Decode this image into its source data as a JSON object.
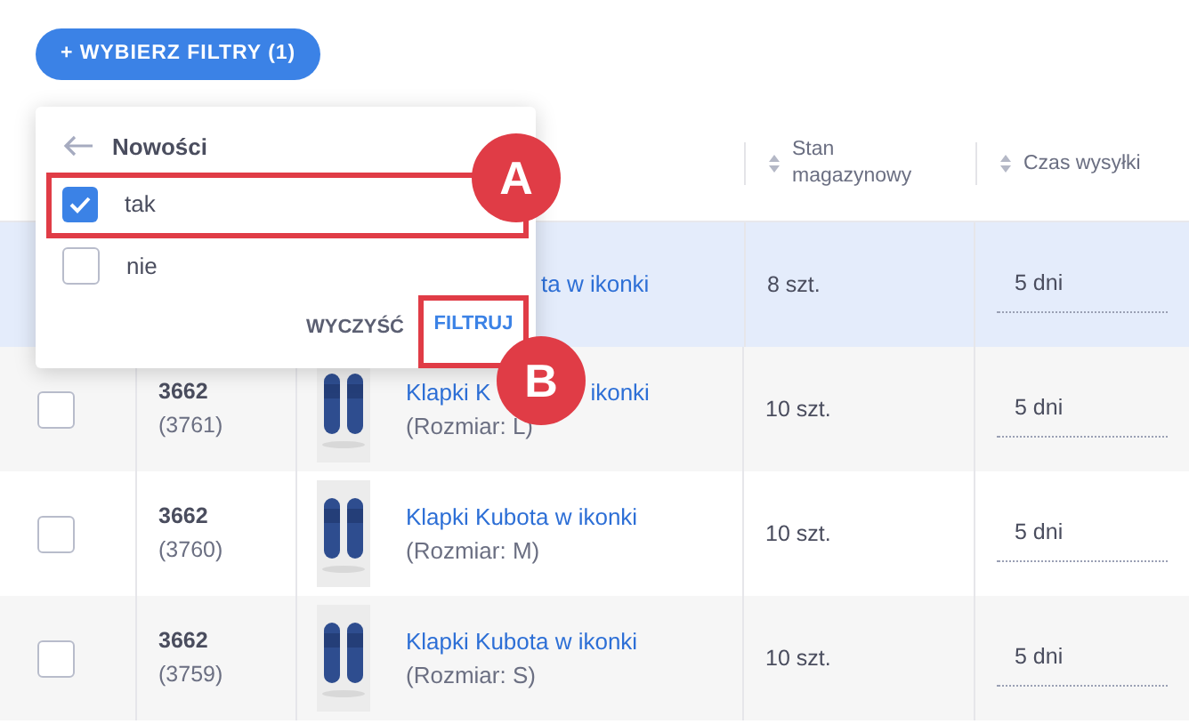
{
  "filter_button": {
    "label": "+ WYBIERZ FILTRY (1)"
  },
  "table": {
    "columns": [
      {
        "label": "Stan magazynowy"
      },
      {
        "label": "Czas wysyłki"
      }
    ],
    "rows": [
      {
        "kind": "covered",
        "name": "ta w ikonki",
        "stock": "8 szt.",
        "shipping": "5 dni",
        "highlighted": true
      },
      {
        "kind": "item",
        "checked": false,
        "id": "3662",
        "variant_id": "(3761)",
        "name": "Klapki K",
        "name_end": "ikonki",
        "size": "(Rozmiar: L)",
        "stock": "10 szt.",
        "shipping": "5 dni",
        "highlighted": false
      },
      {
        "kind": "item",
        "checked": false,
        "id": "3662",
        "variant_id": "(3760)",
        "name": "Klapki Kubota w ikonki",
        "size": "(Rozmiar: M)",
        "stock": "10 szt.",
        "shipping": "5 dni",
        "highlighted": false
      },
      {
        "kind": "item",
        "checked": false,
        "id": "3662",
        "variant_id": "(3759)",
        "name": "Klapki Kubota w ikonki",
        "size": "(Rozmiar: S)",
        "stock": "10 szt.",
        "shipping": "5 dni",
        "highlighted": false
      }
    ]
  },
  "filter_popup": {
    "title": "Nowości",
    "options": [
      {
        "label": "tak",
        "checked": true
      },
      {
        "label": "nie",
        "checked": false
      }
    ],
    "clear_button": "WYCZYŚĆ",
    "apply_button": "FILTRUJ"
  },
  "annotations": [
    {
      "label": "A"
    },
    {
      "label": "B"
    }
  ]
}
